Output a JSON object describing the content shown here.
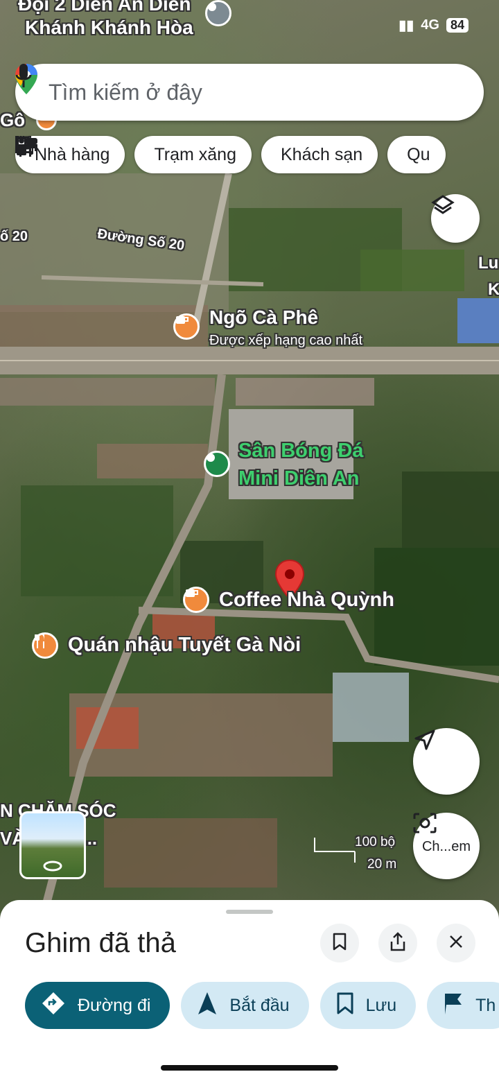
{
  "status_bar": {
    "network": "4G",
    "battery": "84"
  },
  "search": {
    "placeholder": "Tìm kiếm ở đây"
  },
  "chips": [
    {
      "label": "Nhà hàng",
      "icon": "restaurant-icon"
    },
    {
      "label": "Trạm xăng",
      "icon": "gas-station-icon"
    },
    {
      "label": "Khách sạn",
      "icon": "hotel-icon"
    },
    {
      "label": "Qu",
      "icon": "coffee-icon"
    }
  ],
  "map_labels": {
    "top_area": "Đội 2 Diên An Diên",
    "top_area_2": "Khánh Khánh Hòa",
    "left_go": "Gô",
    "road_so20_left": "ố 20",
    "road_so20": "Đường Số 20",
    "right_lu": "Lu",
    "right_k": "K",
    "cafe_name": "Ngõ Cà Phê",
    "cafe_sub": "Được xếp hạng cao nhất",
    "stadium_line1": "Sân Bóng Đá",
    "stadium_line2": "Mini Diên An",
    "coffee": "Coffee Nhà Quỳnh",
    "quan_nhau": "Quán nhậu Tuyết Gà Nòi",
    "bottom_left_1": "N CHĂM SÓC",
    "bottom_left_2": "VÀ OPPO..."
  },
  "scale": {
    "feet": "100 bộ",
    "meters": "20 m"
  },
  "street_view_label": "Ch...em",
  "sheet": {
    "title": "Ghim đã thả",
    "actions": [
      {
        "label": "Đường đi",
        "icon": "directions-icon"
      },
      {
        "label": "Bắt đầu",
        "icon": "navigation-arrow-icon"
      },
      {
        "label": "Lưu",
        "icon": "bookmark-icon"
      },
      {
        "label": "Th",
        "icon": "flag-icon"
      }
    ]
  },
  "colors": {
    "accent": "#0b6176",
    "pin": "#e53935",
    "poi_orange": "#f08a3c",
    "poi_green": "#1e8a4a"
  }
}
